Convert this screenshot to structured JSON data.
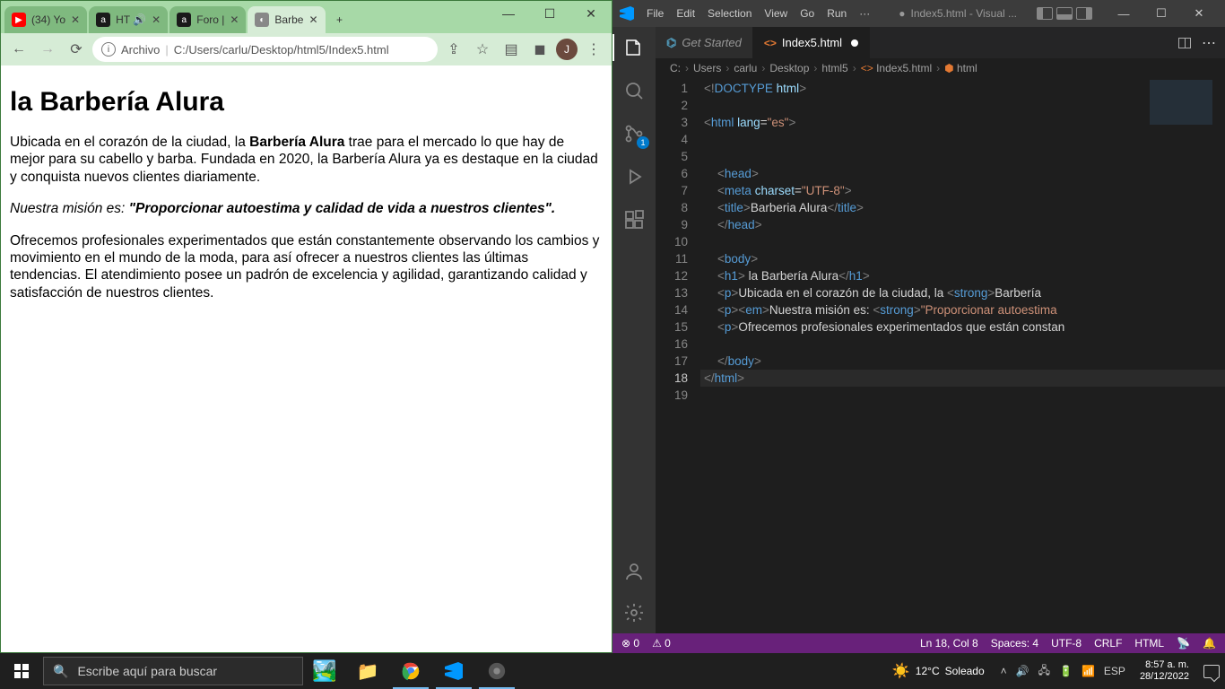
{
  "chrome": {
    "tabs": [
      {
        "favicon_color": "#ff0000",
        "favicon_text": "▶",
        "label": "(34) Yo"
      },
      {
        "favicon_color": "#1a1a1a",
        "favicon_text": "a",
        "label": "HT 🔊"
      },
      {
        "favicon_color": "#1a1a1a",
        "favicon_text": "a",
        "label": "Foro |"
      },
      {
        "favicon_color": "#888",
        "favicon_text": "◐",
        "label": "Barbe",
        "active": true
      }
    ],
    "address_prefix": "Archivo",
    "address_path": "C:/Users/carlu/Desktop/html5/Index5.html",
    "avatar_letter": "J"
  },
  "page": {
    "h1": "la Barbería Alura",
    "p1_a": "Ubicada en el corazón de la ciudad, la ",
    "p1_b": "Barbería Alura",
    "p1_c": " trae para el mercado lo que hay de mejor para su cabello y barba. Fundada en 2020, la Barbería Alura ya es destaque en la ciudad y conquista nuevos clientes diariamente.",
    "p2_a": "Nuestra misión es: ",
    "p2_b": "\"Proporcionar autoestima y calidad de vida a nuestros clientes\".",
    "p3": "Ofrecemos profesionales experimentados que están constantemente observando los cambios y movimiento en el mundo de la moda, para así ofrecer a nuestros clientes las últimas tendencias. El atendimiento posee un padrón de excelencia y agilidad, garantizando calidad y satisfacción de nuestros clientes."
  },
  "vscode": {
    "menu": [
      "File",
      "Edit",
      "Selection",
      "View",
      "Go",
      "Run",
      "···"
    ],
    "title_dot": "●",
    "title_file": "Index5.html - Visual ...",
    "tabs": {
      "getstarted": "Get Started",
      "file": "Index5.html"
    },
    "breadcrumb": [
      "C:",
      "Users",
      "carlu",
      "Desktop",
      "html5",
      "Index5.html",
      "html"
    ],
    "scm_badge": "1",
    "lines": [
      {
        "n": "1",
        "html": "<span class='c-grey'>&lt;!</span><span class='c-blue'>DOCTYPE</span> <span class='c-lblue'>html</span><span class='c-grey'>&gt;</span>"
      },
      {
        "n": "2",
        "html": ""
      },
      {
        "n": "3",
        "html": "<span class='c-grey'>&lt;</span><span class='c-blue'>html</span> <span class='c-lblue'>lang</span><span class='c-white'>=</span><span class='c-orange'>\"es\"</span><span class='c-grey'>&gt;</span>"
      },
      {
        "n": "4",
        "html": ""
      },
      {
        "n": "5",
        "html": ""
      },
      {
        "n": "6",
        "html": "    <span class='c-grey'>&lt;</span><span class='c-blue'>head</span><span class='c-grey'>&gt;</span>"
      },
      {
        "n": "7",
        "html": "    <span class='c-grey'>&lt;</span><span class='c-blue'>meta</span> <span class='c-lblue'>charset</span><span class='c-white'>=</span><span class='c-orange'>\"UTF-8\"</span><span class='c-grey'>&gt;</span>"
      },
      {
        "n": "8",
        "html": "    <span class='c-grey'>&lt;</span><span class='c-blue'>title</span><span class='c-grey'>&gt;</span><span class='c-white'>Barberia Alura</span><span class='c-grey'>&lt;/</span><span class='c-blue'>title</span><span class='c-grey'>&gt;</span>"
      },
      {
        "n": "9",
        "html": "    <span class='c-grey'>&lt;/</span><span class='c-blue'>head</span><span class='c-grey'>&gt;</span>"
      },
      {
        "n": "10",
        "html": ""
      },
      {
        "n": "11",
        "html": "    <span class='c-grey'>&lt;</span><span class='c-blue'>body</span><span class='c-grey'>&gt;</span>"
      },
      {
        "n": "12",
        "html": "    <span class='c-grey'>&lt;</span><span class='c-blue'>h1</span><span class='c-grey'>&gt;</span><span class='c-white'> la Barbería Alura</span><span class='c-grey'>&lt;/</span><span class='c-blue'>h1</span><span class='c-grey'>&gt;</span>"
      },
      {
        "n": "13",
        "html": "    <span class='c-grey'>&lt;</span><span class='c-blue'>p</span><span class='c-grey'>&gt;</span><span class='c-white'>Ubicada en el corazón de la ciudad, la </span><span class='c-grey'>&lt;</span><span class='c-blue'>strong</span><span class='c-grey'>&gt;</span><span class='c-white'>Barbería</span>"
      },
      {
        "n": "14",
        "html": "    <span class='c-grey'>&lt;</span><span class='c-blue'>p</span><span class='c-grey'>&gt;&lt;</span><span class='c-blue'>em</span><span class='c-grey'>&gt;</span><span class='c-white'>Nuestra misión es: </span><span class='c-grey'>&lt;</span><span class='c-blue'>strong</span><span class='c-grey'>&gt;</span><span class='c-orange'>\"Proporcionar autoestima</span>"
      },
      {
        "n": "15",
        "html": "    <span class='c-grey'>&lt;</span><span class='c-blue'>p</span><span class='c-grey'>&gt;</span><span class='c-white'>Ofrecemos profesionales experimentados que están constan</span>"
      },
      {
        "n": "16",
        "html": ""
      },
      {
        "n": "17",
        "html": "    <span class='c-grey'>&lt;/</span><span class='c-blue'>body</span><span class='c-grey'>&gt;</span>"
      },
      {
        "n": "18",
        "html": "<span class='c-grey'>&lt;/</span><span class='c-blue'>html</span><span class='c-grey'>&gt;</span>",
        "current": true
      },
      {
        "n": "19",
        "html": ""
      }
    ],
    "status": {
      "errors": "0",
      "warnings": "0",
      "ln_col": "Ln 18, Col 8",
      "spaces": "Spaces: 4",
      "enc": "UTF-8",
      "eol": "CRLF",
      "lang": "HTML"
    }
  },
  "taskbar": {
    "search_placeholder": "Escribe aquí para buscar",
    "weather_temp": "12°C",
    "weather_desc": "Soleado",
    "lang": "ESP",
    "time": "8:57 a. m.",
    "date": "28/12/2022"
  }
}
